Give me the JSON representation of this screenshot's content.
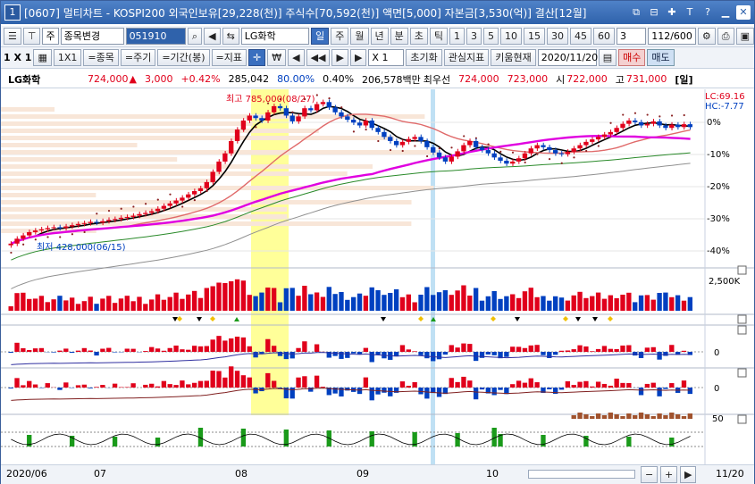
{
  "window": {
    "number": "1",
    "title": "[0607] 멀티차트 - KOSPI200 외국인보유[29,228(천)] 주식수[70,592(천)] 액면[5,000] 자본금[3,530(억)] 결산[12월]",
    "controls": [
      "⧉",
      "⊟",
      "✚",
      "T",
      "?",
      "▁",
      "✕"
    ]
  },
  "toolbar1": {
    "period_type": "주",
    "stock_change": "종목변경",
    "code": "051910",
    "stock_name": "LG화학",
    "periods": [
      "일",
      "주",
      "월",
      "년",
      "분",
      "초",
      "틱"
    ],
    "selected_period": "일",
    "intervals": [
      "1",
      "3",
      "5",
      "10",
      "15",
      "30",
      "45",
      "60"
    ],
    "interval_value": "3",
    "count": "112/600"
  },
  "toolbar2": {
    "grid": "1 X 1",
    "ratio": "1X1",
    "stock_btn": "=종목",
    "period_btn": "=주기",
    "range_btn": "=기간(봉)",
    "indicator_btn": "=지표",
    "nav": [
      "◀",
      "◀◀",
      "▶",
      "▶"
    ],
    "zoom": "X 1",
    "reset": "초기화",
    "interest": "관심지표",
    "kiwoom": "키움현재",
    "date": "2020/11/20",
    "buy": "매수",
    "sell": "매도"
  },
  "info": {
    "name": "LG화학",
    "price": "724,000",
    "arrow": "▲",
    "change": "3,000",
    "change_pct": "+0.42%",
    "volume": "285,042",
    "rate": "80.00%",
    "vol_ratio": "0.40%",
    "amount": "206,578백만",
    "ask_label": "최우선",
    "ask": "724,000",
    "bid": "723,000",
    "open_label": "시",
    "open": "722,000",
    "high_label": "고",
    "high": "731,000",
    "tag": "[일]"
  },
  "chart_data": {
    "type": "candlestick",
    "x_axis": [
      "2020/06",
      "07",
      "08",
      "09",
      "10",
      "11",
      "11/20"
    ],
    "y_axis_pct": [
      "0%",
      "-10%",
      "-20%",
      "-30%",
      "-40%"
    ],
    "lc": "LC:69.16",
    "hc": "HC:-7.77",
    "max_label": "최고 785,000(08/27)",
    "min_label": "최저 428,000(06/15)",
    "volume_label": "2,500K",
    "osc_labels": [
      "0",
      "0",
      "50"
    ],
    "closes": [
      440,
      452,
      460,
      468,
      472,
      475,
      478,
      480,
      478,
      482,
      485,
      488,
      490,
      493,
      491,
      495,
      498,
      500,
      503,
      505,
      508,
      512,
      515,
      519,
      525,
      532,
      538,
      545,
      552,
      560,
      568,
      575,
      590,
      615,
      640,
      660,
      690,
      718,
      740,
      752,
      746,
      740,
      760,
      775,
      770,
      752,
      738,
      750,
      770,
      765,
      780,
      785,
      772,
      760,
      750,
      742,
      735,
      728,
      740,
      722,
      712,
      700,
      690,
      680,
      688,
      695,
      700,
      690,
      675,
      662,
      650,
      640,
      652,
      665,
      680,
      690,
      675,
      668,
      660,
      650,
      642,
      635,
      640,
      648,
      660,
      672,
      680,
      675,
      668,
      660,
      658,
      664,
      672,
      680,
      688,
      694,
      700,
      706,
      712,
      722,
      732,
      740,
      736,
      728,
      732,
      738,
      728,
      722,
      730,
      724,
      731,
      724
    ],
    "colors": {
      "up": "#e0001b",
      "down": "#0040c0",
      "ma5": "#000000",
      "ma20": "#e06a6a",
      "ma60": "#e000e0",
      "ma120": "#2a8a2a",
      "ma240": "#909090",
      "parabolic": "#8b2222",
      "highlight": "#ffff80",
      "marker": "#b0d8f0"
    }
  }
}
